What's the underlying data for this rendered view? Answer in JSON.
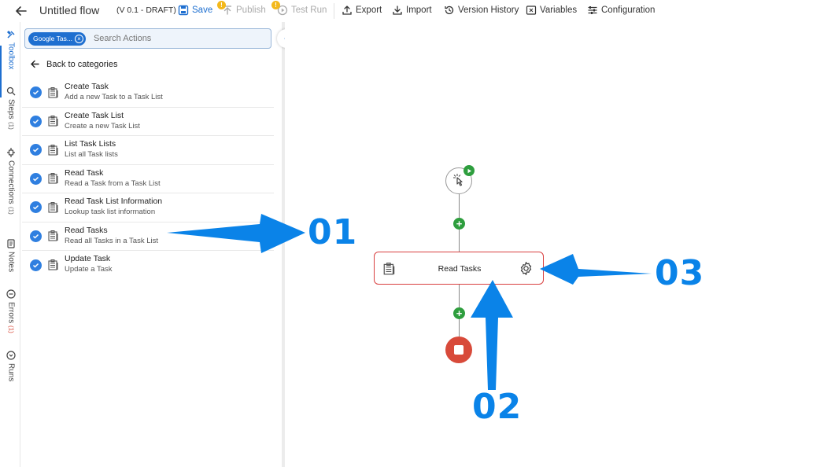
{
  "header": {
    "title": "Untitled flow",
    "version": "(V 0.1 - DRAFT)",
    "save_label": "Save",
    "publish_label": "Publish",
    "test_run_label": "Test Run",
    "publish_badge": "!",
    "test_badge": "!",
    "export_label": "Export",
    "import_label": "Import",
    "history_label": "Version History",
    "variables_label": "Variables",
    "config_label": "Configuration"
  },
  "rail": {
    "toolbox": "Toolbox",
    "steps": "Steps",
    "steps_count": "(1)",
    "connections": "Connections",
    "connections_count": "(1)",
    "notes": "Notes",
    "errors": "Errors",
    "errors_count": "(1)",
    "runs": "Runs"
  },
  "toolbox": {
    "filter_chip": "Google Tas...",
    "search_placeholder": "Search Actions",
    "back_label": "Back to categories",
    "actions": [
      {
        "title": "Create Task",
        "desc": "Add a new Task to a Task List"
      },
      {
        "title": "Create Task List",
        "desc": "Create a new Task List"
      },
      {
        "title": "List Task Lists",
        "desc": "List all Task lists"
      },
      {
        "title": "Read Task",
        "desc": "Read a Task from a Task List"
      },
      {
        "title": "Read Task List Information",
        "desc": "Lookup task list information"
      },
      {
        "title": "Read Tasks",
        "desc": "Read all Tasks in a Task List"
      },
      {
        "title": "Update Task",
        "desc": "Update a Task"
      }
    ]
  },
  "canvas": {
    "step_label": "Read Tasks"
  },
  "callouts": {
    "one": "01",
    "two": "02",
    "three": "03"
  },
  "colors": {
    "accent": "#1e6fd0",
    "callout": "#0a83e8",
    "success": "#2e9e3e",
    "danger": "#d84a3a",
    "warning": "#f3b81b"
  }
}
